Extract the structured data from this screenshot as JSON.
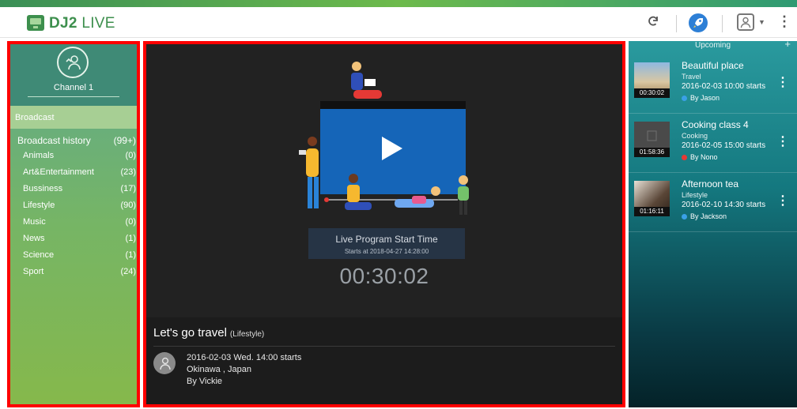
{
  "header": {
    "app_name_bold": "DJ2",
    "app_name_rest": " LIVE"
  },
  "sidebar": {
    "channel_name": "Channel 1",
    "broadcast_tab": "Broadcast",
    "history": {
      "label": "Broadcast history",
      "count": "(99+)"
    },
    "categories": [
      {
        "label": "Animals",
        "count": "(0)"
      },
      {
        "label": "Art&Entertainment",
        "count": "(23)"
      },
      {
        "label": "Bussiness",
        "count": "(17)"
      },
      {
        "label": "Lifestyle",
        "count": "(90)"
      },
      {
        "label": "Music",
        "count": "(0)"
      },
      {
        "label": "News",
        "count": "(1)"
      },
      {
        "label": "Science",
        "count": "(1)"
      },
      {
        "label": "Sport",
        "count": "(24)"
      }
    ]
  },
  "main": {
    "badge_title": "Live Program Start Time",
    "badge_sub": "Starts at 2018-04-27 14:28:00",
    "timer": "00:30:02",
    "program_title": "Let's go travel",
    "program_category": "(Lifestyle)",
    "program_time": "2016-02-03 Wed. 14:00 starts",
    "program_location": "Okinawa , Japan",
    "program_host": "By  Vickie"
  },
  "upcoming": {
    "header": "Upcoming",
    "add_label": "+",
    "items": [
      {
        "title": "Beautiful place",
        "category": "Travel",
        "time": "2016-02-03  10:00 starts",
        "by": "By Jason",
        "duration": "00:30:02",
        "by_color": "#3aa0e6"
      },
      {
        "title": "Cooking class 4",
        "category": "Cooking",
        "time": "2016-02-05  15:00 starts",
        "by": "By Nono",
        "duration": "01:58:36",
        "by_color": "#e53935"
      },
      {
        "title": "Afternoon tea",
        "category": "Lifestyle",
        "time": "2016-02-10  14:30 starts",
        "by": "By Jackson",
        "duration": "01:16:11",
        "by_color": "#3aa0e6"
      }
    ]
  },
  "colors": {
    "accent_green": "#3d8f4d",
    "highlight_border": "#ff0000",
    "play_panel": "#1565b8"
  },
  "icons": {
    "refresh": "refresh-icon",
    "rocket": "rocket-icon",
    "user": "user-icon",
    "more": "more-icon",
    "play": "play-icon"
  }
}
